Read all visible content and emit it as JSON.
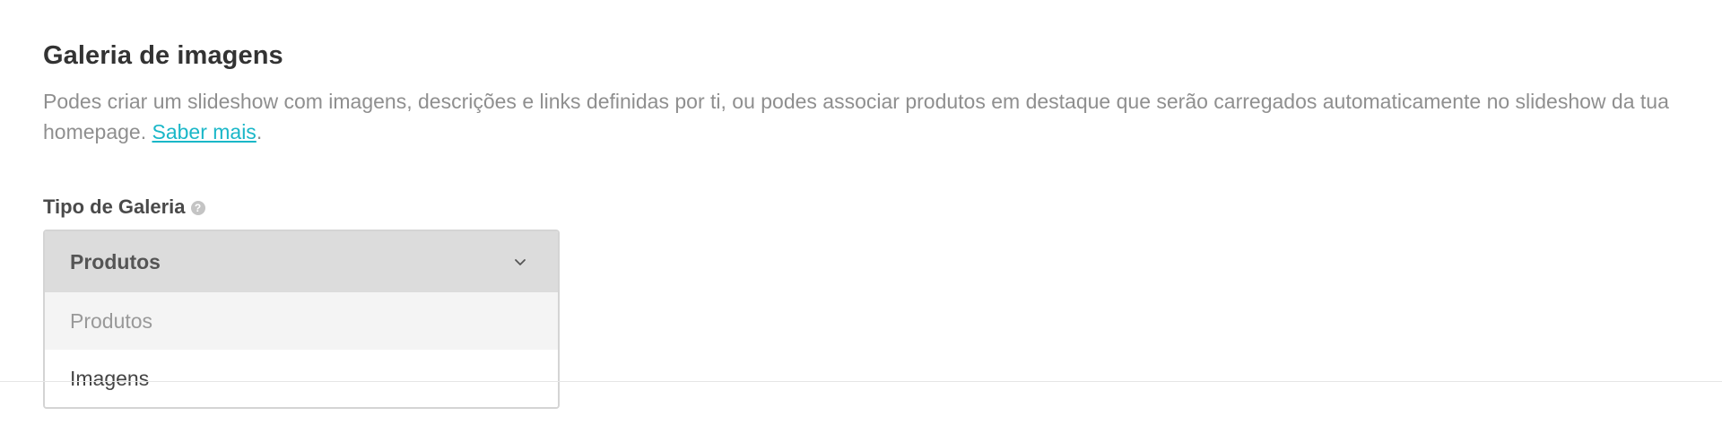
{
  "section": {
    "title": "Galeria de imagens",
    "description": "Podes criar um slideshow com imagens, descrições e links definidas por ti, ou podes associar produtos em destaque que serão carregados automaticamente no slideshow da tua homepage.",
    "description_before_link": "Podes criar um slideshow com imagens, descrições e links definidas por ti, ou podes associar produtos em destaque que serão carregados automaticamente no slideshow da tua homepage. ",
    "link_label": "Saber mais",
    "description_after_link": "."
  },
  "field": {
    "label": "Tipo de Galeria",
    "help_icon": "question-icon",
    "help_glyph": "?",
    "selected_value": "Produtos",
    "chevron_icon": "chevron-down-icon",
    "options": [
      {
        "label": "Produtos",
        "highlighted": true
      },
      {
        "label": "Imagens",
        "highlighted": false
      }
    ]
  },
  "colors": {
    "link": "#1ab7c8",
    "select_head_bg": "#dcdcdc",
    "option_highlight_bg": "#f4f4f4"
  }
}
